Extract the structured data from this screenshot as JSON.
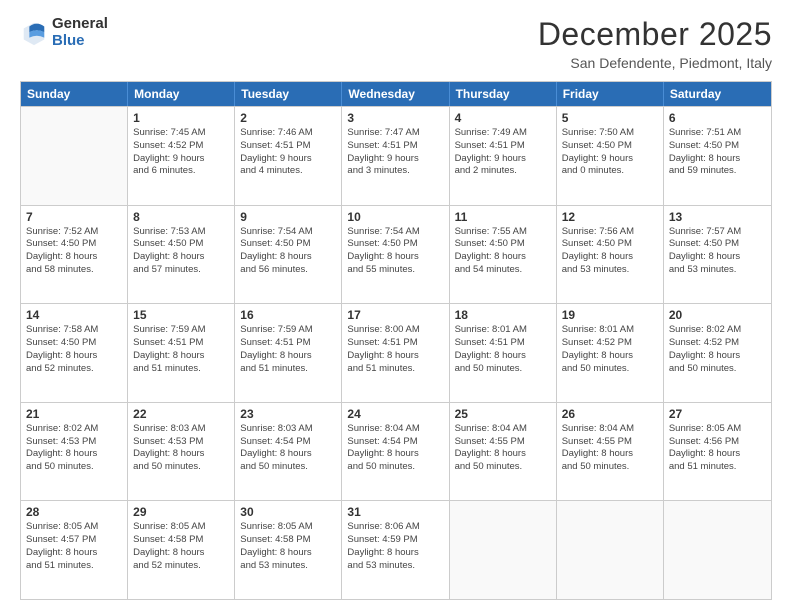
{
  "logo": {
    "general": "General",
    "blue": "Blue"
  },
  "header": {
    "month": "December 2025",
    "location": "San Defendente, Piedmont, Italy"
  },
  "weekdays": [
    "Sunday",
    "Monday",
    "Tuesday",
    "Wednesday",
    "Thursday",
    "Friday",
    "Saturday"
  ],
  "weeks": [
    [
      {
        "day": "",
        "info": ""
      },
      {
        "day": "1",
        "info": "Sunrise: 7:45 AM\nSunset: 4:52 PM\nDaylight: 9 hours\nand 6 minutes."
      },
      {
        "day": "2",
        "info": "Sunrise: 7:46 AM\nSunset: 4:51 PM\nDaylight: 9 hours\nand 4 minutes."
      },
      {
        "day": "3",
        "info": "Sunrise: 7:47 AM\nSunset: 4:51 PM\nDaylight: 9 hours\nand 3 minutes."
      },
      {
        "day": "4",
        "info": "Sunrise: 7:49 AM\nSunset: 4:51 PM\nDaylight: 9 hours\nand 2 minutes."
      },
      {
        "day": "5",
        "info": "Sunrise: 7:50 AM\nSunset: 4:50 PM\nDaylight: 9 hours\nand 0 minutes."
      },
      {
        "day": "6",
        "info": "Sunrise: 7:51 AM\nSunset: 4:50 PM\nDaylight: 8 hours\nand 59 minutes."
      }
    ],
    [
      {
        "day": "7",
        "info": "Sunrise: 7:52 AM\nSunset: 4:50 PM\nDaylight: 8 hours\nand 58 minutes."
      },
      {
        "day": "8",
        "info": "Sunrise: 7:53 AM\nSunset: 4:50 PM\nDaylight: 8 hours\nand 57 minutes."
      },
      {
        "day": "9",
        "info": "Sunrise: 7:54 AM\nSunset: 4:50 PM\nDaylight: 8 hours\nand 56 minutes."
      },
      {
        "day": "10",
        "info": "Sunrise: 7:54 AM\nSunset: 4:50 PM\nDaylight: 8 hours\nand 55 minutes."
      },
      {
        "day": "11",
        "info": "Sunrise: 7:55 AM\nSunset: 4:50 PM\nDaylight: 8 hours\nand 54 minutes."
      },
      {
        "day": "12",
        "info": "Sunrise: 7:56 AM\nSunset: 4:50 PM\nDaylight: 8 hours\nand 53 minutes."
      },
      {
        "day": "13",
        "info": "Sunrise: 7:57 AM\nSunset: 4:50 PM\nDaylight: 8 hours\nand 53 minutes."
      }
    ],
    [
      {
        "day": "14",
        "info": "Sunrise: 7:58 AM\nSunset: 4:50 PM\nDaylight: 8 hours\nand 52 minutes."
      },
      {
        "day": "15",
        "info": "Sunrise: 7:59 AM\nSunset: 4:51 PM\nDaylight: 8 hours\nand 51 minutes."
      },
      {
        "day": "16",
        "info": "Sunrise: 7:59 AM\nSunset: 4:51 PM\nDaylight: 8 hours\nand 51 minutes."
      },
      {
        "day": "17",
        "info": "Sunrise: 8:00 AM\nSunset: 4:51 PM\nDaylight: 8 hours\nand 51 minutes."
      },
      {
        "day": "18",
        "info": "Sunrise: 8:01 AM\nSunset: 4:51 PM\nDaylight: 8 hours\nand 50 minutes."
      },
      {
        "day": "19",
        "info": "Sunrise: 8:01 AM\nSunset: 4:52 PM\nDaylight: 8 hours\nand 50 minutes."
      },
      {
        "day": "20",
        "info": "Sunrise: 8:02 AM\nSunset: 4:52 PM\nDaylight: 8 hours\nand 50 minutes."
      }
    ],
    [
      {
        "day": "21",
        "info": "Sunrise: 8:02 AM\nSunset: 4:53 PM\nDaylight: 8 hours\nand 50 minutes."
      },
      {
        "day": "22",
        "info": "Sunrise: 8:03 AM\nSunset: 4:53 PM\nDaylight: 8 hours\nand 50 minutes."
      },
      {
        "day": "23",
        "info": "Sunrise: 8:03 AM\nSunset: 4:54 PM\nDaylight: 8 hours\nand 50 minutes."
      },
      {
        "day": "24",
        "info": "Sunrise: 8:04 AM\nSunset: 4:54 PM\nDaylight: 8 hours\nand 50 minutes."
      },
      {
        "day": "25",
        "info": "Sunrise: 8:04 AM\nSunset: 4:55 PM\nDaylight: 8 hours\nand 50 minutes."
      },
      {
        "day": "26",
        "info": "Sunrise: 8:04 AM\nSunset: 4:55 PM\nDaylight: 8 hours\nand 50 minutes."
      },
      {
        "day": "27",
        "info": "Sunrise: 8:05 AM\nSunset: 4:56 PM\nDaylight: 8 hours\nand 51 minutes."
      }
    ],
    [
      {
        "day": "28",
        "info": "Sunrise: 8:05 AM\nSunset: 4:57 PM\nDaylight: 8 hours\nand 51 minutes."
      },
      {
        "day": "29",
        "info": "Sunrise: 8:05 AM\nSunset: 4:58 PM\nDaylight: 8 hours\nand 52 minutes."
      },
      {
        "day": "30",
        "info": "Sunrise: 8:05 AM\nSunset: 4:58 PM\nDaylight: 8 hours\nand 53 minutes."
      },
      {
        "day": "31",
        "info": "Sunrise: 8:06 AM\nSunset: 4:59 PM\nDaylight: 8 hours\nand 53 minutes."
      },
      {
        "day": "",
        "info": ""
      },
      {
        "day": "",
        "info": ""
      },
      {
        "day": "",
        "info": ""
      }
    ]
  ]
}
